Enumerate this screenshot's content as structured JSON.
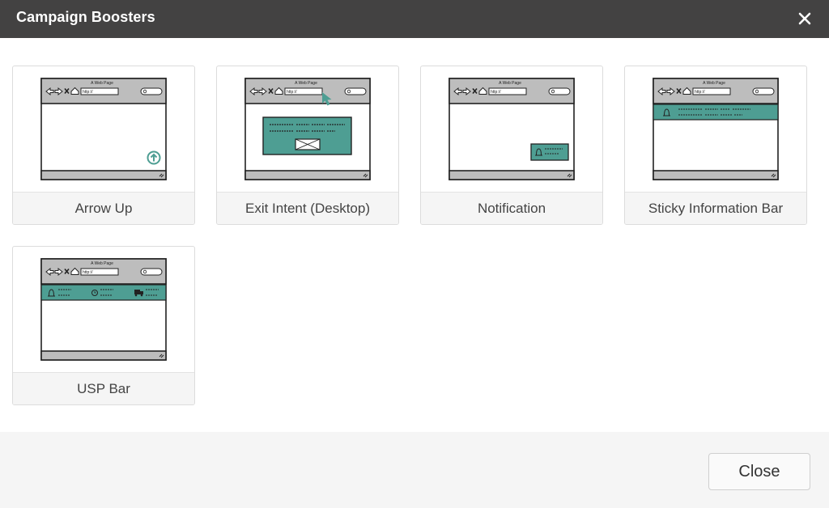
{
  "dialog": {
    "title": "Campaign Boosters",
    "close_icon": "close-icon"
  },
  "browser_mock": {
    "page_title": "A Web Page",
    "url": "http://"
  },
  "boosters": [
    {
      "label": "Arrow Up"
    },
    {
      "label": "Exit Intent (Desktop)"
    },
    {
      "label": "Notification"
    },
    {
      "label": "Sticky Information Bar"
    },
    {
      "label": "USP Bar"
    }
  ],
  "footer": {
    "close_label": "Close"
  },
  "colors": {
    "header_bg": "#434242",
    "accent_teal": "#4e9e93",
    "footer_bg": "#f5f5f5"
  }
}
